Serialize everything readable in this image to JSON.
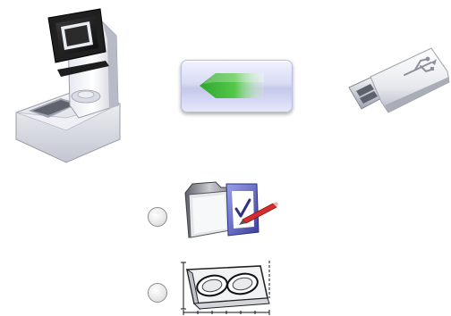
{
  "screen": {
    "background": "#ffffff"
  },
  "icons": {
    "source_device": "edging-machine-icon",
    "transfer_direction": "arrow-left-icon",
    "destination_device": "usb-drive-icon",
    "files_option": "folder-checklist-icon",
    "shapes_option": "lens-shape-template-icon"
  },
  "options": [
    {
      "icon": "folder-checklist-icon",
      "selected": false
    },
    {
      "icon": "lens-shape-template-icon",
      "selected": false
    }
  ],
  "colors": {
    "arrow_green": "#3cb43c",
    "button_face": "#d8dbf4",
    "screen_dark": "#1a1a1a"
  }
}
